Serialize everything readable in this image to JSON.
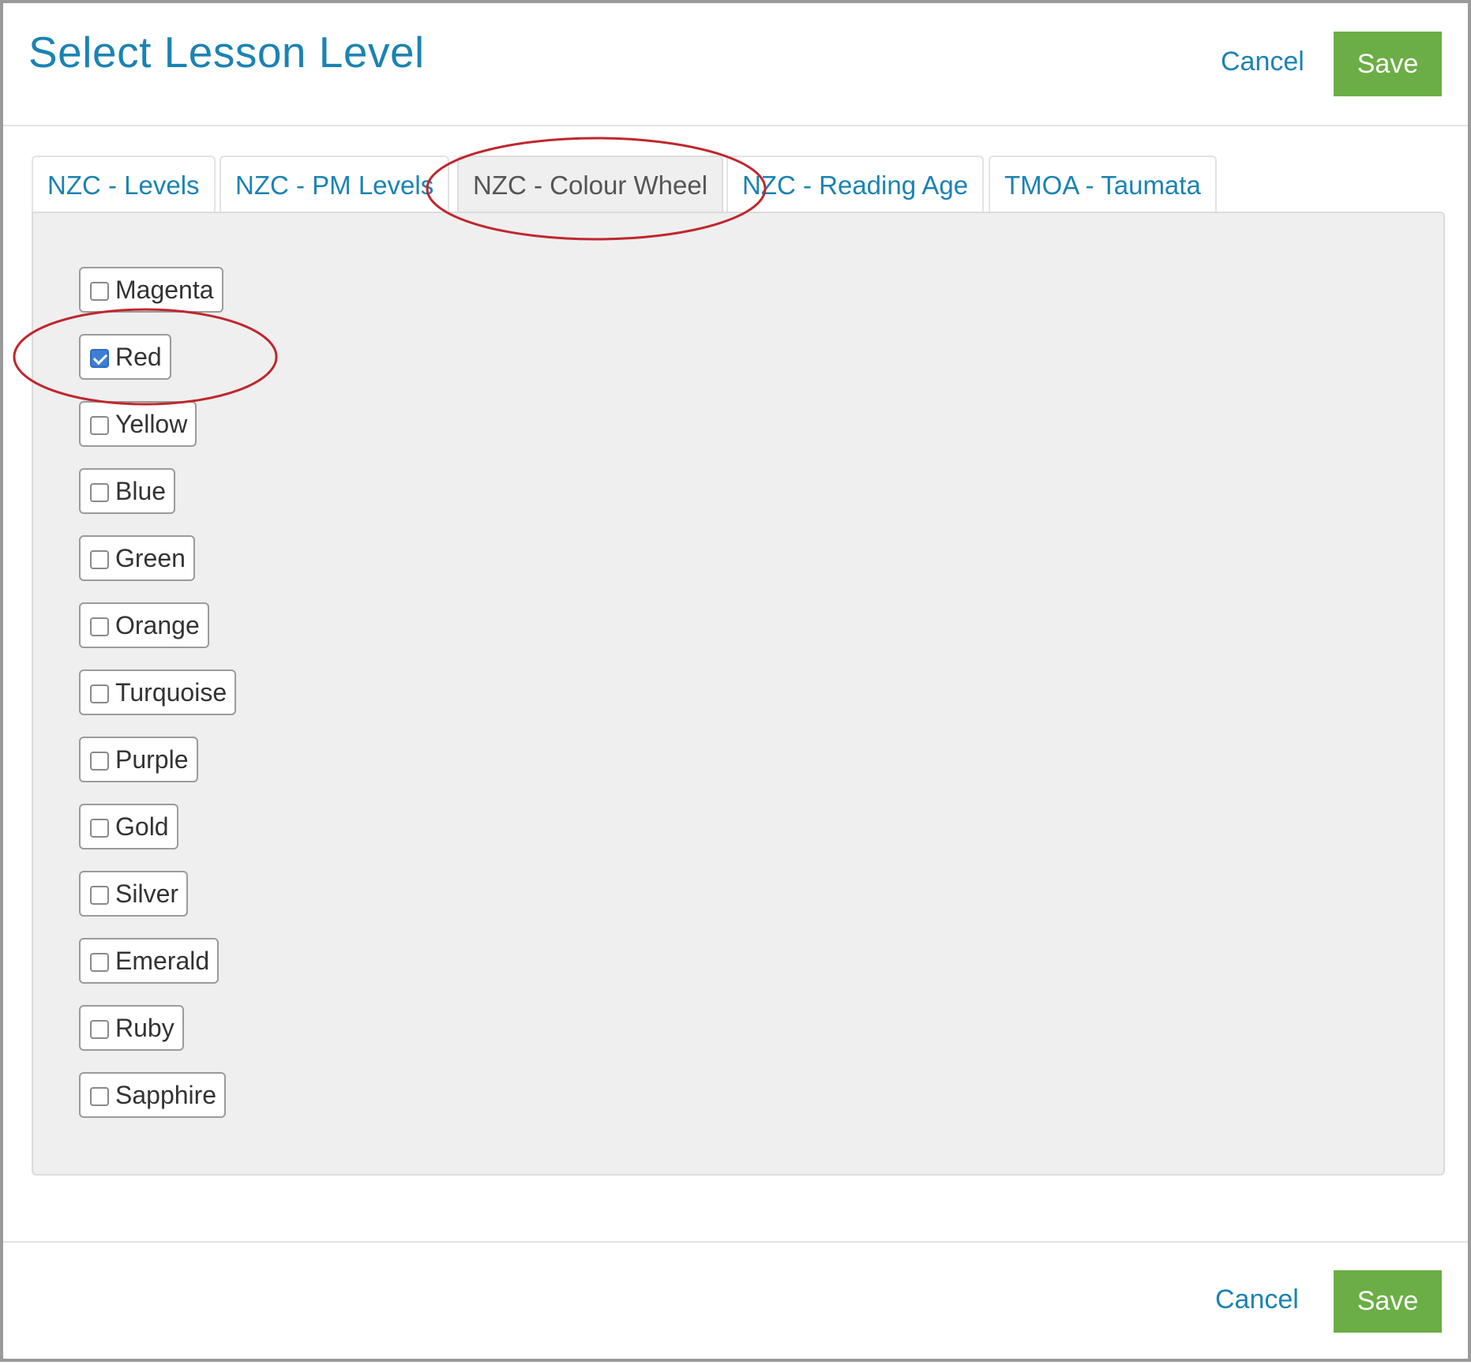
{
  "dialog": {
    "title": "Select Lesson Level"
  },
  "header": {
    "cancel_label": "Cancel",
    "save_label": "Save"
  },
  "tabs": [
    {
      "label": "NZC - Levels",
      "active": false
    },
    {
      "label": "NZC - PM Levels",
      "active": false
    },
    {
      "label": "NZC - Colour Wheel",
      "active": true
    },
    {
      "label": "NZC - Reading Age",
      "active": false
    },
    {
      "label": "TMOA - Taumata",
      "active": false
    }
  ],
  "options": [
    {
      "label": "Magenta",
      "checked": false
    },
    {
      "label": "Red",
      "checked": true
    },
    {
      "label": "Yellow",
      "checked": false
    },
    {
      "label": "Blue",
      "checked": false
    },
    {
      "label": "Green",
      "checked": false
    },
    {
      "label": "Orange",
      "checked": false
    },
    {
      "label": "Turquoise",
      "checked": false
    },
    {
      "label": "Purple",
      "checked": false
    },
    {
      "label": "Gold",
      "checked": false
    },
    {
      "label": "Silver",
      "checked": false
    },
    {
      "label": "Emerald",
      "checked": false
    },
    {
      "label": "Ruby",
      "checked": false
    },
    {
      "label": "Sapphire",
      "checked": false
    }
  ],
  "footer": {
    "cancel_label": "Cancel",
    "save_label": "Save"
  },
  "colors": {
    "accent": "#1b83b3",
    "save_button": "#6bae45",
    "annotation": "#c0272d",
    "checkbox_checked": "#3d7fd6"
  }
}
